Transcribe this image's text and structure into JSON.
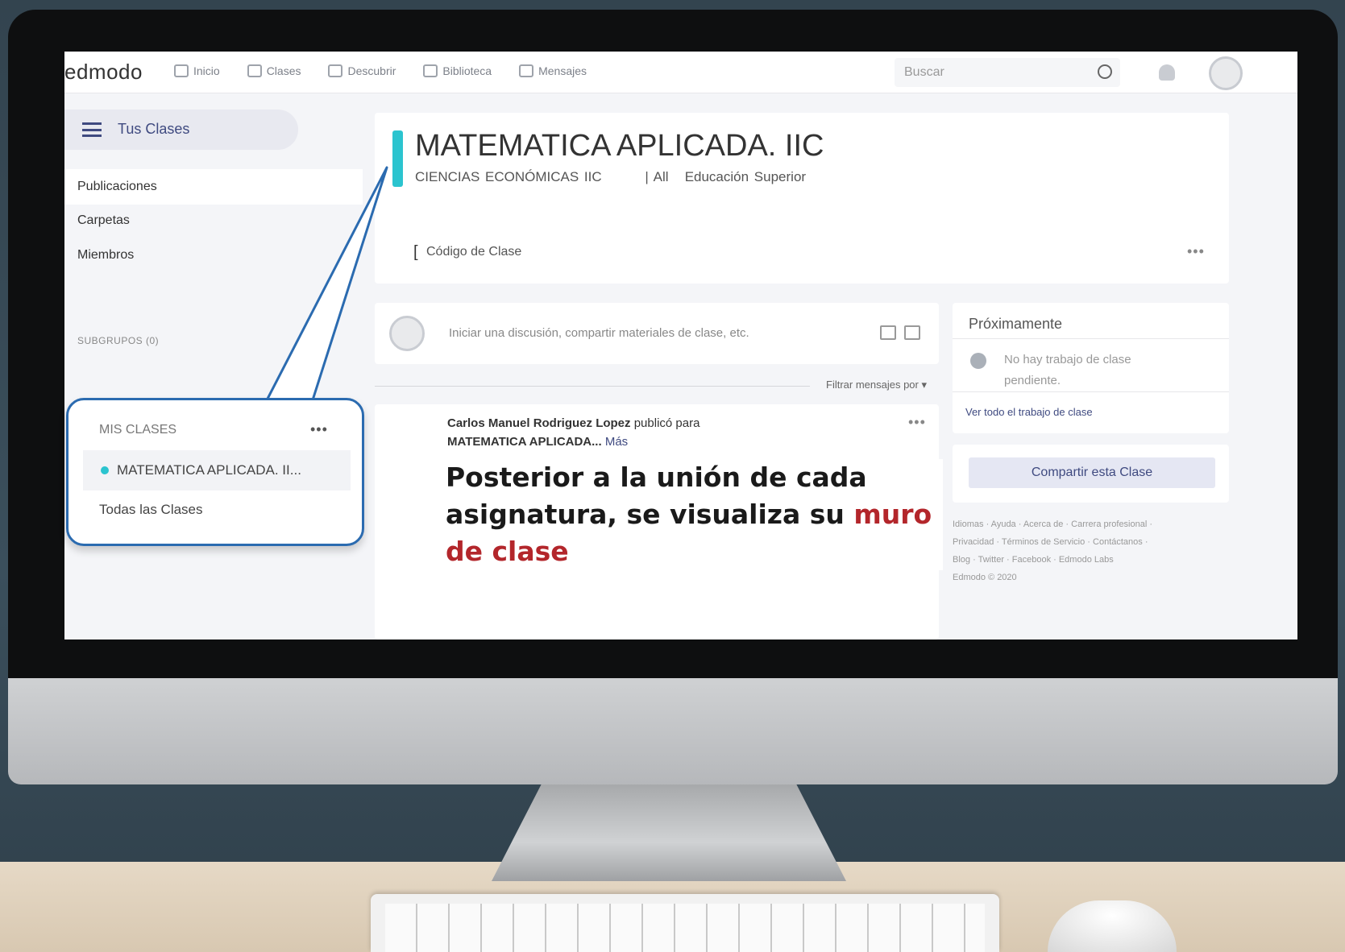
{
  "topbar": {
    "logo": "edmodo",
    "nav": [
      {
        "label": "Inicio",
        "icon": "home-icon"
      },
      {
        "label": "Clases",
        "icon": "classes-icon"
      },
      {
        "label": "Descubrir",
        "icon": "discover-icon"
      },
      {
        "label": "Biblioteca",
        "icon": "library-icon"
      },
      {
        "label": "Mensajes",
        "icon": "messages-icon"
      }
    ],
    "search_placeholder": "Buscar"
  },
  "sidebar": {
    "header": "Tus Clases",
    "items": [
      {
        "label": "Publicaciones"
      },
      {
        "label": "Carpetas"
      },
      {
        "label": "Miembros"
      }
    ],
    "subgroups": "SUBGRUPOS (0)"
  },
  "class": {
    "title": "MATEMATICA APLICADA. IIC",
    "subtitle": "CIENCIAS ECONÓMICAS IIC        | All   Educación Superior",
    "code_label": "Código de Clase",
    "accent_color": "#2bc4cf"
  },
  "feed": {
    "composer_placeholder": "Iniciar una discusión, compartir materiales de clase, etc.",
    "filter_label": "Filtrar mensajes por ▾",
    "post": {
      "author": "Carlos Manuel Rodriguez Lopez",
      "action": "publicó para",
      "target": "MATEMATICA APLICADA...",
      "more": "Más"
    }
  },
  "upcoming": {
    "title": "Próximamente",
    "empty": "No hay trabajo de clase pendiente.",
    "link": "Ver todo el trabajo de clase"
  },
  "share_button": "Compartir esta Clase",
  "footer": {
    "line1": "Idiomas · Ayuda · Acerca de · Carrera profesional ·",
    "line2": "Privacidad · Términos de Servicio · Contáctanos ·",
    "line3": "Blog · Twitter · Facebook · Edmodo Labs",
    "line4": "Edmodo © 2020"
  },
  "callout": {
    "header": "MIS CLASES",
    "selected_class": "MATEMATICA APLICADA. II...",
    "all_classes": "Todas las Clases"
  },
  "overlay": {
    "text_part1": "Posterior a la unión de cada asignatura, se visualiza su",
    "text_highlight": "muro de clase",
    "highlight_color": "#b3262b"
  },
  "more_glyph": "•••"
}
